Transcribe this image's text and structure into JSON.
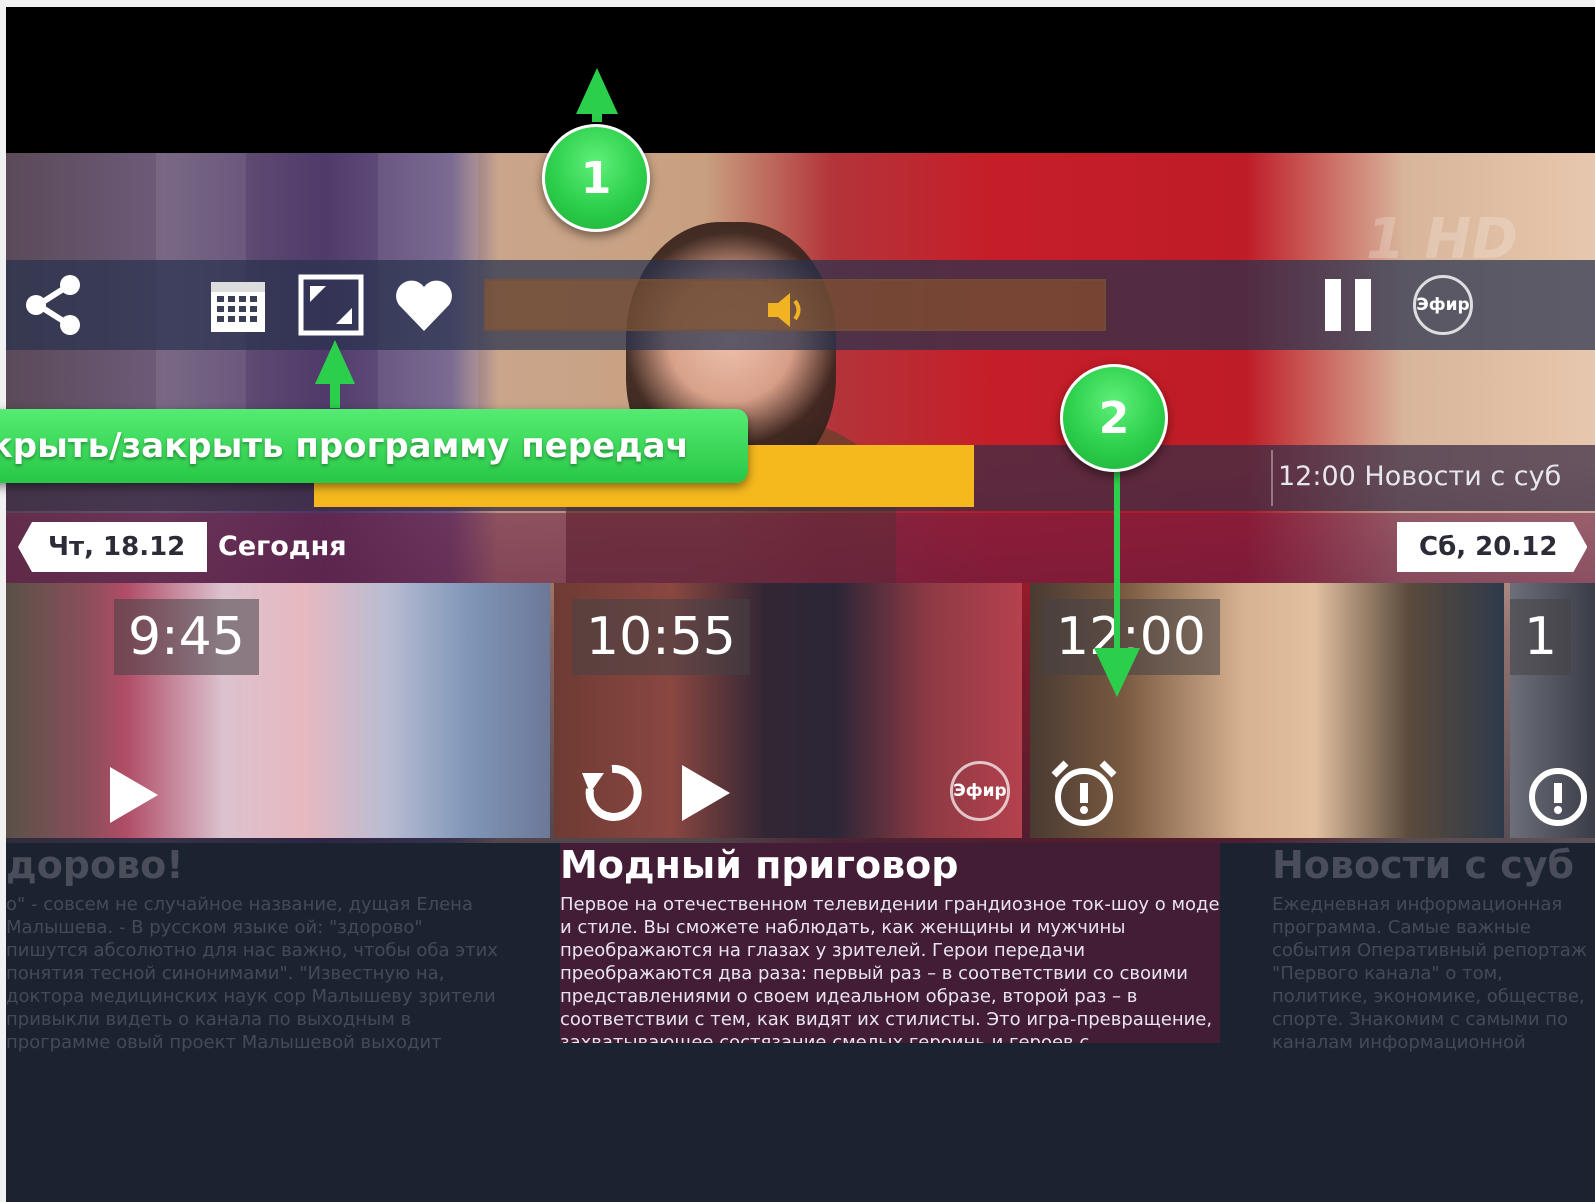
{
  "colors": {
    "accent_green": "#2ccf4b",
    "progress_yellow": "#f6b91d",
    "background_dark": "#1b2230"
  },
  "video": {
    "channel_watermark": "1 HD"
  },
  "controls": {
    "share_icon": "share-icon",
    "calendar_icon": "calendar-icon",
    "guide_toggle_icon": "guide-toggle-icon",
    "favorite_icon": "heart-icon",
    "volume_icon": "volume-icon",
    "pause_icon": "pause-icon",
    "live_label": "Эфир"
  },
  "timeline": {
    "current_progress": 0.55,
    "next_program": "12:00 Новости с суб"
  },
  "days": {
    "prev": "Чт, 18.12",
    "today": "Сегодня",
    "next": "Сб, 20.12"
  },
  "programs": [
    {
      "time": "9:45",
      "title": "дорово!",
      "description": "о\" - совсем не случайное название, дущая Елена Малышева. - В русском языке ой: \"здорово\" пишутся абсолютно для нас важно, чтобы оба этих понятия тесной синонимами\". \"Известную на, доктора медицинских наук сор Малышеву зрители привыкли видеть о канала по выходным в программе овый проект Малышевой выходит будням. \"Все рассказывают - мы лечим\"! Рассказывают многие, а мы будем лечить\" - говорит Елена Малышева. - Для"
    },
    {
      "time": "10:55",
      "title": "Модный приговор",
      "live_label": "Эфир",
      "description": "Первое на отечественном телевидении грандиозное ток-шоу о моде и стиле. Вы сможете наблюдать, как женщины и мужчины преображаются на глазах у зрителей. Герои передачи преображаются два раза: первый раз – в соответствии со своими представлениями о своем идеальном образе, второй раз – в соответствии с тем, как видят их стилисты. Это игра-превращение, захватывающее состязание смелых героинь и героев с профессионалами."
    },
    {
      "time": "12:00",
      "title": "Новости с суб",
      "description": "Ежедневная информационная программа. Самые важные события Оперативный репортаж \"Первого канала\" о том, политике, экономике, обществе, спорте. Знакомим с самыми по каналам информационной"
    },
    {
      "time": "1"
    }
  ],
  "annotations": {
    "marker_1": "1",
    "marker_2": "2",
    "guide_label": "ткрыть/закрыть программу передач"
  }
}
